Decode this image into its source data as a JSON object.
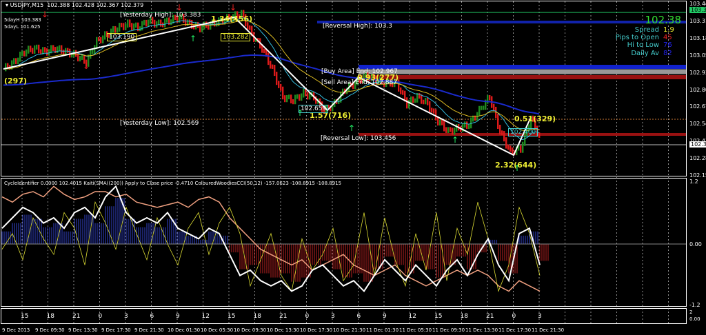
{
  "header": {
    "symbol": "USDJPY,M15",
    "ohlc": "102.388 102.428 102.367 102.379",
    "five_day_high": "5dayH 103.383",
    "five_day_low": "5dayL 101.625"
  },
  "labels": {
    "yesterday_high": "[Yesterday High]: 103.383",
    "yesterday_low": "[Yesterday Low]: 102.569",
    "reversal_high": "[Reversal High]: 103.3",
    "reversal_low": "[Reversal Low]: 103.456",
    "buy_area": "[Buy Area] End: 102.967",
    "sell_area": "[Sell Area] End: 102.887",
    "wave1": "(297)",
    "wave2": "1.34(456)",
    "wave3": "1.57(716)",
    "wave4": "2.32(644)",
    "wave5": "0.51(329)",
    "mid_wave": "0.93(277)",
    "box1": "103.190",
    "box2": "103.282",
    "box3": "102.659",
    "box4": "102.400"
  },
  "info_panel": {
    "price": "102.38",
    "spread_label": "Spread",
    "spread": "1.9",
    "pips_label": "Pips to Open",
    "pips": "45",
    "hilo_label": "Hi to Low",
    "hilo": "76",
    "daily_label": "Daily Av",
    "daily": "82",
    "colors": {
      "price": "#33dd33",
      "spread": "#ffff33",
      "pips": "#ee2222",
      "hilo": "#2222ee",
      "daily": "#2222ee"
    }
  },
  "indicator_header": "CycleIdentifier 0.0000 102.4015  Kaiti(SMA((200)) Apply to Close price -0.4710  ColouredWoodiesCCI(50,12) -157.0623 -108.8915 -108.8915",
  "price_axis": [
    "103.445",
    "103.315",
    "103.185",
    "103.050",
    "102.930",
    "102.800",
    "102.670",
    "102.540",
    "102.410",
    "102.280",
    "102.150"
  ],
  "price_markers": {
    "high": "103.383",
    "current": "102.379"
  },
  "indicator_axis": [
    "1.2",
    "0.00",
    "-1.2"
  ],
  "sub_axis": [
    "2",
    "0.00"
  ],
  "hour_labels": [
    "15",
    "18",
    "21",
    "0",
    "3",
    "6",
    "9",
    "12",
    "15",
    "18",
    "21",
    "0",
    "3",
    "6",
    "9",
    "12",
    "15",
    "18",
    "21",
    "0",
    "3"
  ],
  "date_labels": [
    "9 Dec 2013",
    "9 Dec 09:30",
    "9 Dec 13:30",
    "9 Dec 17:30",
    "9 Dec 21:30",
    "10 Dec 01:30",
    "10 Dec 05:30",
    "10 Dec 09:30",
    "10 Dec 13:30",
    "10 Dec 17:30",
    "10 Dec 21:30",
    "11 Dec 01:30",
    "11 Dec 05:30",
    "11 Dec 09:30",
    "11 Dec 13:30",
    "11 Dec 17:30",
    "11 Dec 21:30"
  ],
  "chart_data": {
    "type": "line",
    "title": "USDJPY,M15",
    "ylim": [
      102.15,
      103.445
    ],
    "close": [
      102.949,
      103.001,
      103.08,
      103.106,
      103.08,
      103.106,
      103.08,
      103.054,
      103.001,
      103.158,
      103.21,
      103.262,
      103.288,
      103.262,
      103.314,
      103.288,
      103.314,
      103.341,
      103.288,
      103.262,
      103.288,
      103.314,
      103.341,
      103.367,
      103.21,
      103.106,
      102.949,
      102.74,
      102.714,
      102.766,
      102.74,
      102.636,
      102.688,
      102.793,
      102.845,
      102.897,
      102.871,
      102.845,
      102.845,
      102.688,
      102.74,
      102.688,
      102.558,
      102.479,
      102.505,
      102.532,
      102.636,
      102.74,
      102.479,
      102.323,
      102.349,
      102.584,
      102.401
    ],
    "osc_white": [
      0.3,
      0.5,
      0.7,
      0.6,
      0.4,
      0.5,
      0.3,
      0.6,
      0.7,
      0.5,
      0.9,
      1.1,
      0.6,
      0.4,
      0.5,
      0.4,
      0.6,
      0.3,
      0.2,
      0.1,
      0.3,
      0.2,
      -0.2,
      -0.6,
      -0.5,
      -0.7,
      -0.8,
      -0.7,
      -0.9,
      -0.8,
      -0.5,
      -0.4,
      -0.6,
      -0.8,
      -0.7,
      -0.9,
      -0.6,
      -0.3,
      -0.5,
      -0.7,
      -0.4,
      -0.6,
      -0.8,
      -0.5,
      -0.3,
      -0.6,
      -0.2,
      0.1,
      -0.4,
      -0.7,
      0.2,
      0.3,
      -0.4
    ],
    "osc_orange": [
      0.9,
      0.8,
      0.95,
      1.0,
      0.9,
      1.1,
      0.95,
      0.85,
      0.9,
      1.0,
      1.0,
      0.9,
      0.95,
      0.8,
      0.75,
      0.7,
      0.75,
      0.8,
      0.7,
      0.85,
      0.9,
      0.8,
      0.5,
      0.3,
      0.1,
      -0.1,
      -0.2,
      -0.3,
      -0.4,
      -0.3,
      -0.5,
      -0.4,
      -0.3,
      -0.2,
      -0.4,
      -0.5,
      -0.6,
      -0.5,
      -0.4,
      -0.6,
      -0.7,
      -0.8,
      -0.7,
      -0.6,
      -0.5,
      -0.6,
      -0.5,
      -0.6,
      -0.8,
      -0.9,
      -0.7,
      -0.8,
      -0.9
    ],
    "osc_yellow": [
      -0.1,
      0.2,
      -0.3,
      0.5,
      0.1,
      -0.2,
      0.6,
      0.3,
      -0.4,
      0.8,
      0.4,
      -0.1,
      0.7,
      0.2,
      -0.3,
      0.5,
      0.0,
      -0.4,
      0.3,
      0.6,
      -0.2,
      0.4,
      0.7,
      0.2,
      -0.8,
      -0.3,
      0.2,
      -0.6,
      -0.9,
      0.1,
      -0.5,
      -0.2,
      0.3,
      -0.7,
      -0.4,
      0.6,
      -0.6,
      0.5,
      -0.3,
      -0.8,
      0.2,
      -0.5,
      0.6,
      -0.7,
      0.3,
      -0.2,
      0.8,
      0.1,
      -0.9,
      -0.4,
      0.7,
      0.2,
      -0.6
    ]
  }
}
